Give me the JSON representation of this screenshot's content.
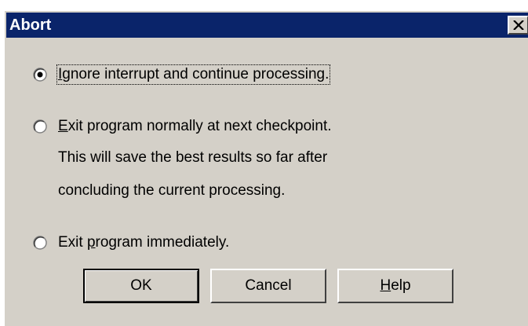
{
  "window": {
    "title": "Abort",
    "close_glyph": "close-icon"
  },
  "options": [
    {
      "label_pre": "",
      "label_access": "I",
      "label_post": "gnore interrupt and continue processing.",
      "selected": true
    },
    {
      "label_pre": "",
      "label_access": "E",
      "label_post": "xit program normally at next checkpoint.",
      "selected": false,
      "description": [
        "This will save the best results so far after",
        "concluding the current processing."
      ]
    },
    {
      "label_pre": "Exit ",
      "label_access": "p",
      "label_post": "rogram immediately.",
      "selected": false
    }
  ],
  "buttons": {
    "ok": "OK",
    "cancel": "Cancel",
    "help_access": "H",
    "help_rest": "elp"
  },
  "colors": {
    "titlebar": "#0a246a",
    "face": "#d4d0c8"
  }
}
